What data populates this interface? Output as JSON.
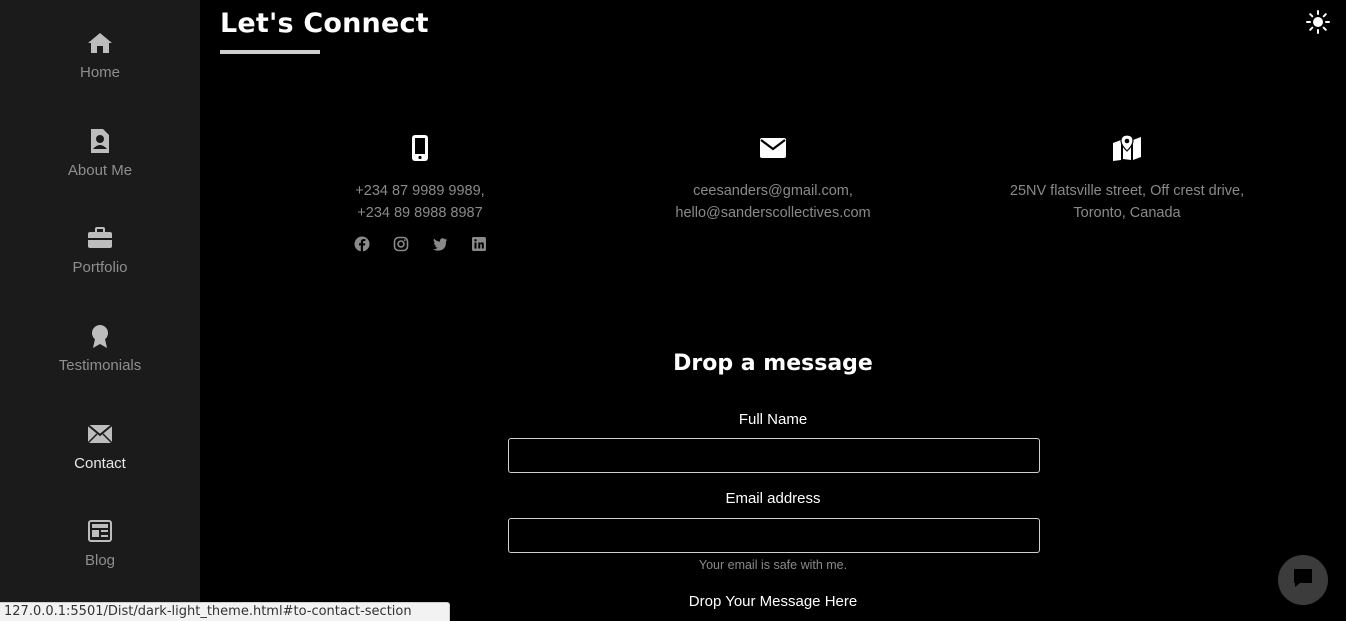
{
  "sidebar": {
    "items": [
      {
        "label": "Home",
        "icon": "home-icon"
      },
      {
        "label": "About Me",
        "icon": "id-card-icon"
      },
      {
        "label": "Portfolio",
        "icon": "briefcase-icon"
      },
      {
        "label": "Testimonials",
        "icon": "award-icon"
      },
      {
        "label": "Contact",
        "icon": "envelope-icon",
        "active": true
      },
      {
        "label": "Blog",
        "icon": "newspaper-icon"
      }
    ]
  },
  "header": {
    "title": "Let's Connect",
    "theme_toggle_icon": "sun-icon"
  },
  "contact": {
    "phone": {
      "icon": "mobile-phone-icon",
      "line1": "+234 87 9989 9989,",
      "line2": "+234 89 8988 8987"
    },
    "email": {
      "icon": "envelope-icon",
      "line1": "ceesanders@gmail.com,",
      "line2": "hello@sanderscollectives.com"
    },
    "address": {
      "icon": "map-pin-icon",
      "line1": "25NV flatsville street, Off crest drive,",
      "line2": "Toronto, Canada"
    },
    "socials": [
      "facebook-icon",
      "instagram-icon",
      "twitter-icon",
      "linkedin-icon"
    ]
  },
  "form": {
    "title": "Drop a message",
    "full_name_label": "Full Name",
    "full_name_value": "",
    "email_label": "Email address",
    "email_value": "",
    "email_helper": "Your email is safe with me.",
    "message_label": "Drop Your Message Here"
  },
  "chat": {
    "icon": "chat-icon"
  },
  "status_bar": {
    "url": "127.0.0.1:5501/Dist/dark-light_theme.html#to-contact-section"
  },
  "colors": {
    "sidebar_bg": "#1b1b1b",
    "page_bg": "#000000",
    "muted_text": "#8a8a8a"
  }
}
